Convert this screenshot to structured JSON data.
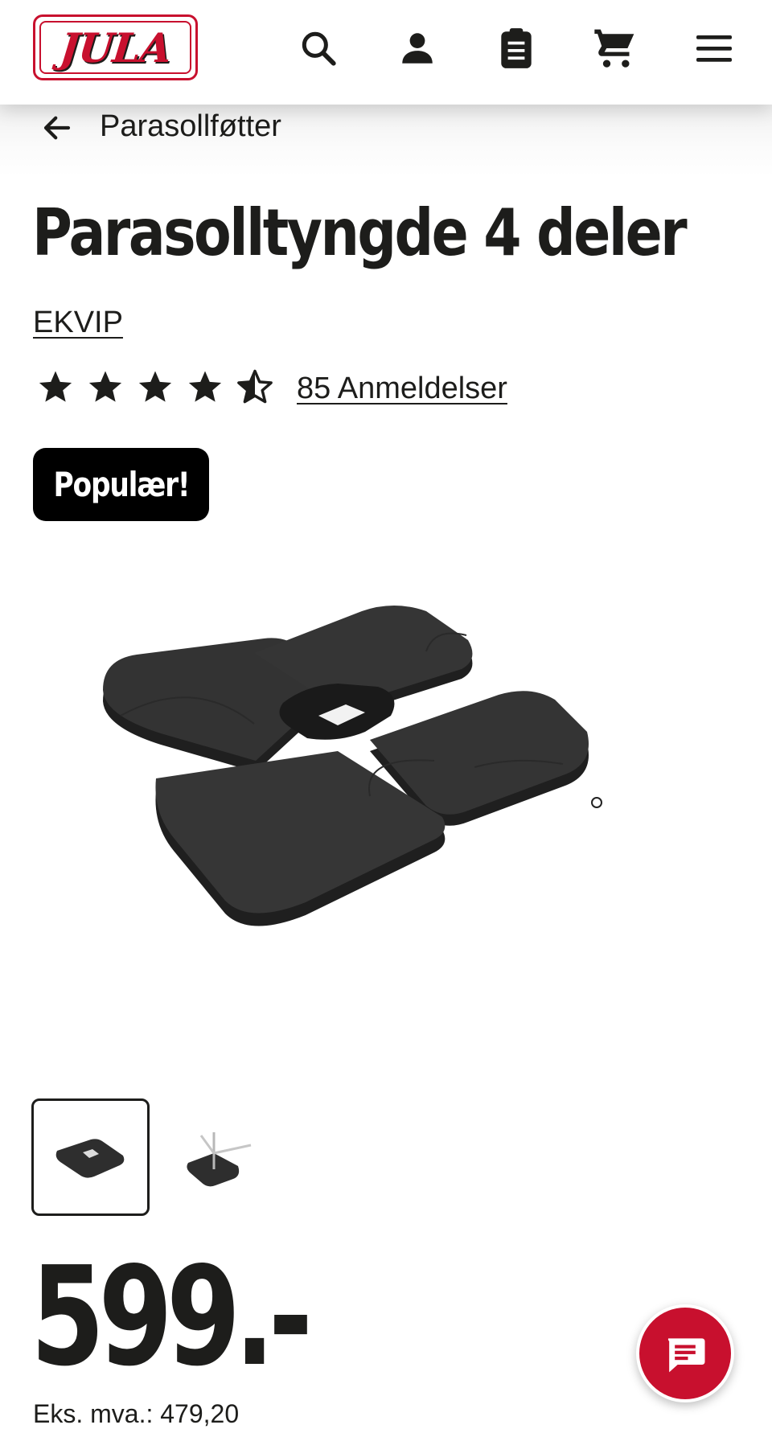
{
  "header": {
    "logo_text": "JULA",
    "icons": [
      "search-icon",
      "account-icon",
      "clipboard-icon",
      "cart-icon",
      "menu-icon"
    ]
  },
  "breadcrumb": {
    "back_icon": "arrow-left-icon",
    "label": "Parasollføtter"
  },
  "product": {
    "title": "Parasolltyngde 4 deler",
    "brand": "EKVIP",
    "rating": 4.5,
    "rating_max": 5,
    "reviews_label": "85 Anmeldelser",
    "badge": "Populær!",
    "image_count": 2,
    "price": "599.-",
    "ex_vat": "Eks. mva.: 479,20"
  },
  "chat": {
    "icon": "chat-icon"
  },
  "colors": {
    "brand_red": "#c8102e",
    "text": "#1d1d1b",
    "badge_bg": "#000000"
  }
}
